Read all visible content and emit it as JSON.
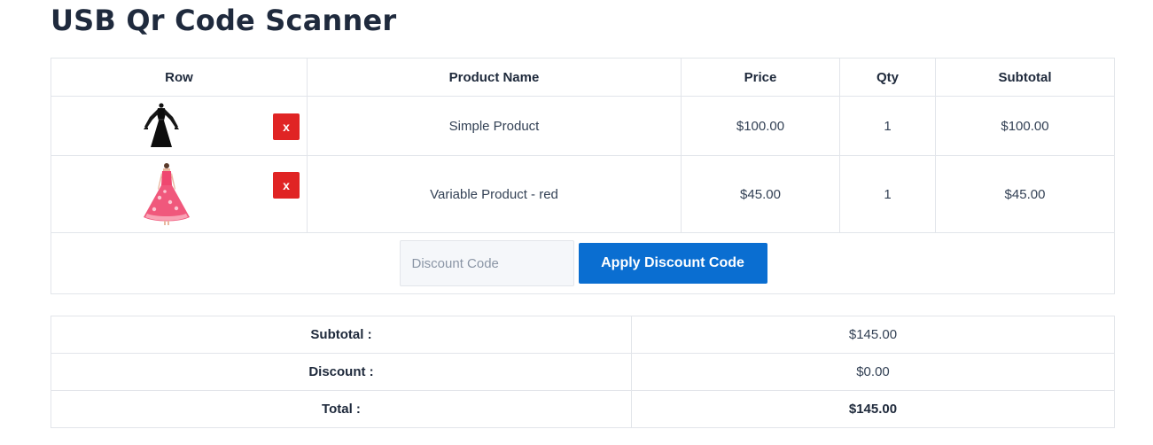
{
  "page": {
    "title": "USB Qr Code Scanner"
  },
  "cart": {
    "columns": [
      "Row",
      "Product Name",
      "Price",
      "Qty",
      "Subtotal"
    ],
    "items": [
      {
        "image_icon": "black-dress-thumbnail",
        "remove_label": "x",
        "name": "Simple Product",
        "price": "$100.00",
        "qty": "1",
        "subtotal": "$100.00"
      },
      {
        "image_icon": "red-dress-thumbnail",
        "remove_label": "x",
        "name": "Variable Product - red",
        "price": "$45.00",
        "qty": "1",
        "subtotal": "$45.00"
      }
    ]
  },
  "discount": {
    "placeholder": "Discount Code",
    "value": "",
    "apply_label": "Apply Discount Code"
  },
  "totals": {
    "subtotal_label": "Subtotal :",
    "subtotal_value": "$145.00",
    "discount_label": "Discount :",
    "discount_value": "$0.00",
    "total_label": "Total :",
    "total_value": "$145.00"
  },
  "colors": {
    "remove_button": "#e02424",
    "apply_button": "#0a6ed1",
    "title": "#1f2a3d",
    "border": "#e2e5ea"
  }
}
